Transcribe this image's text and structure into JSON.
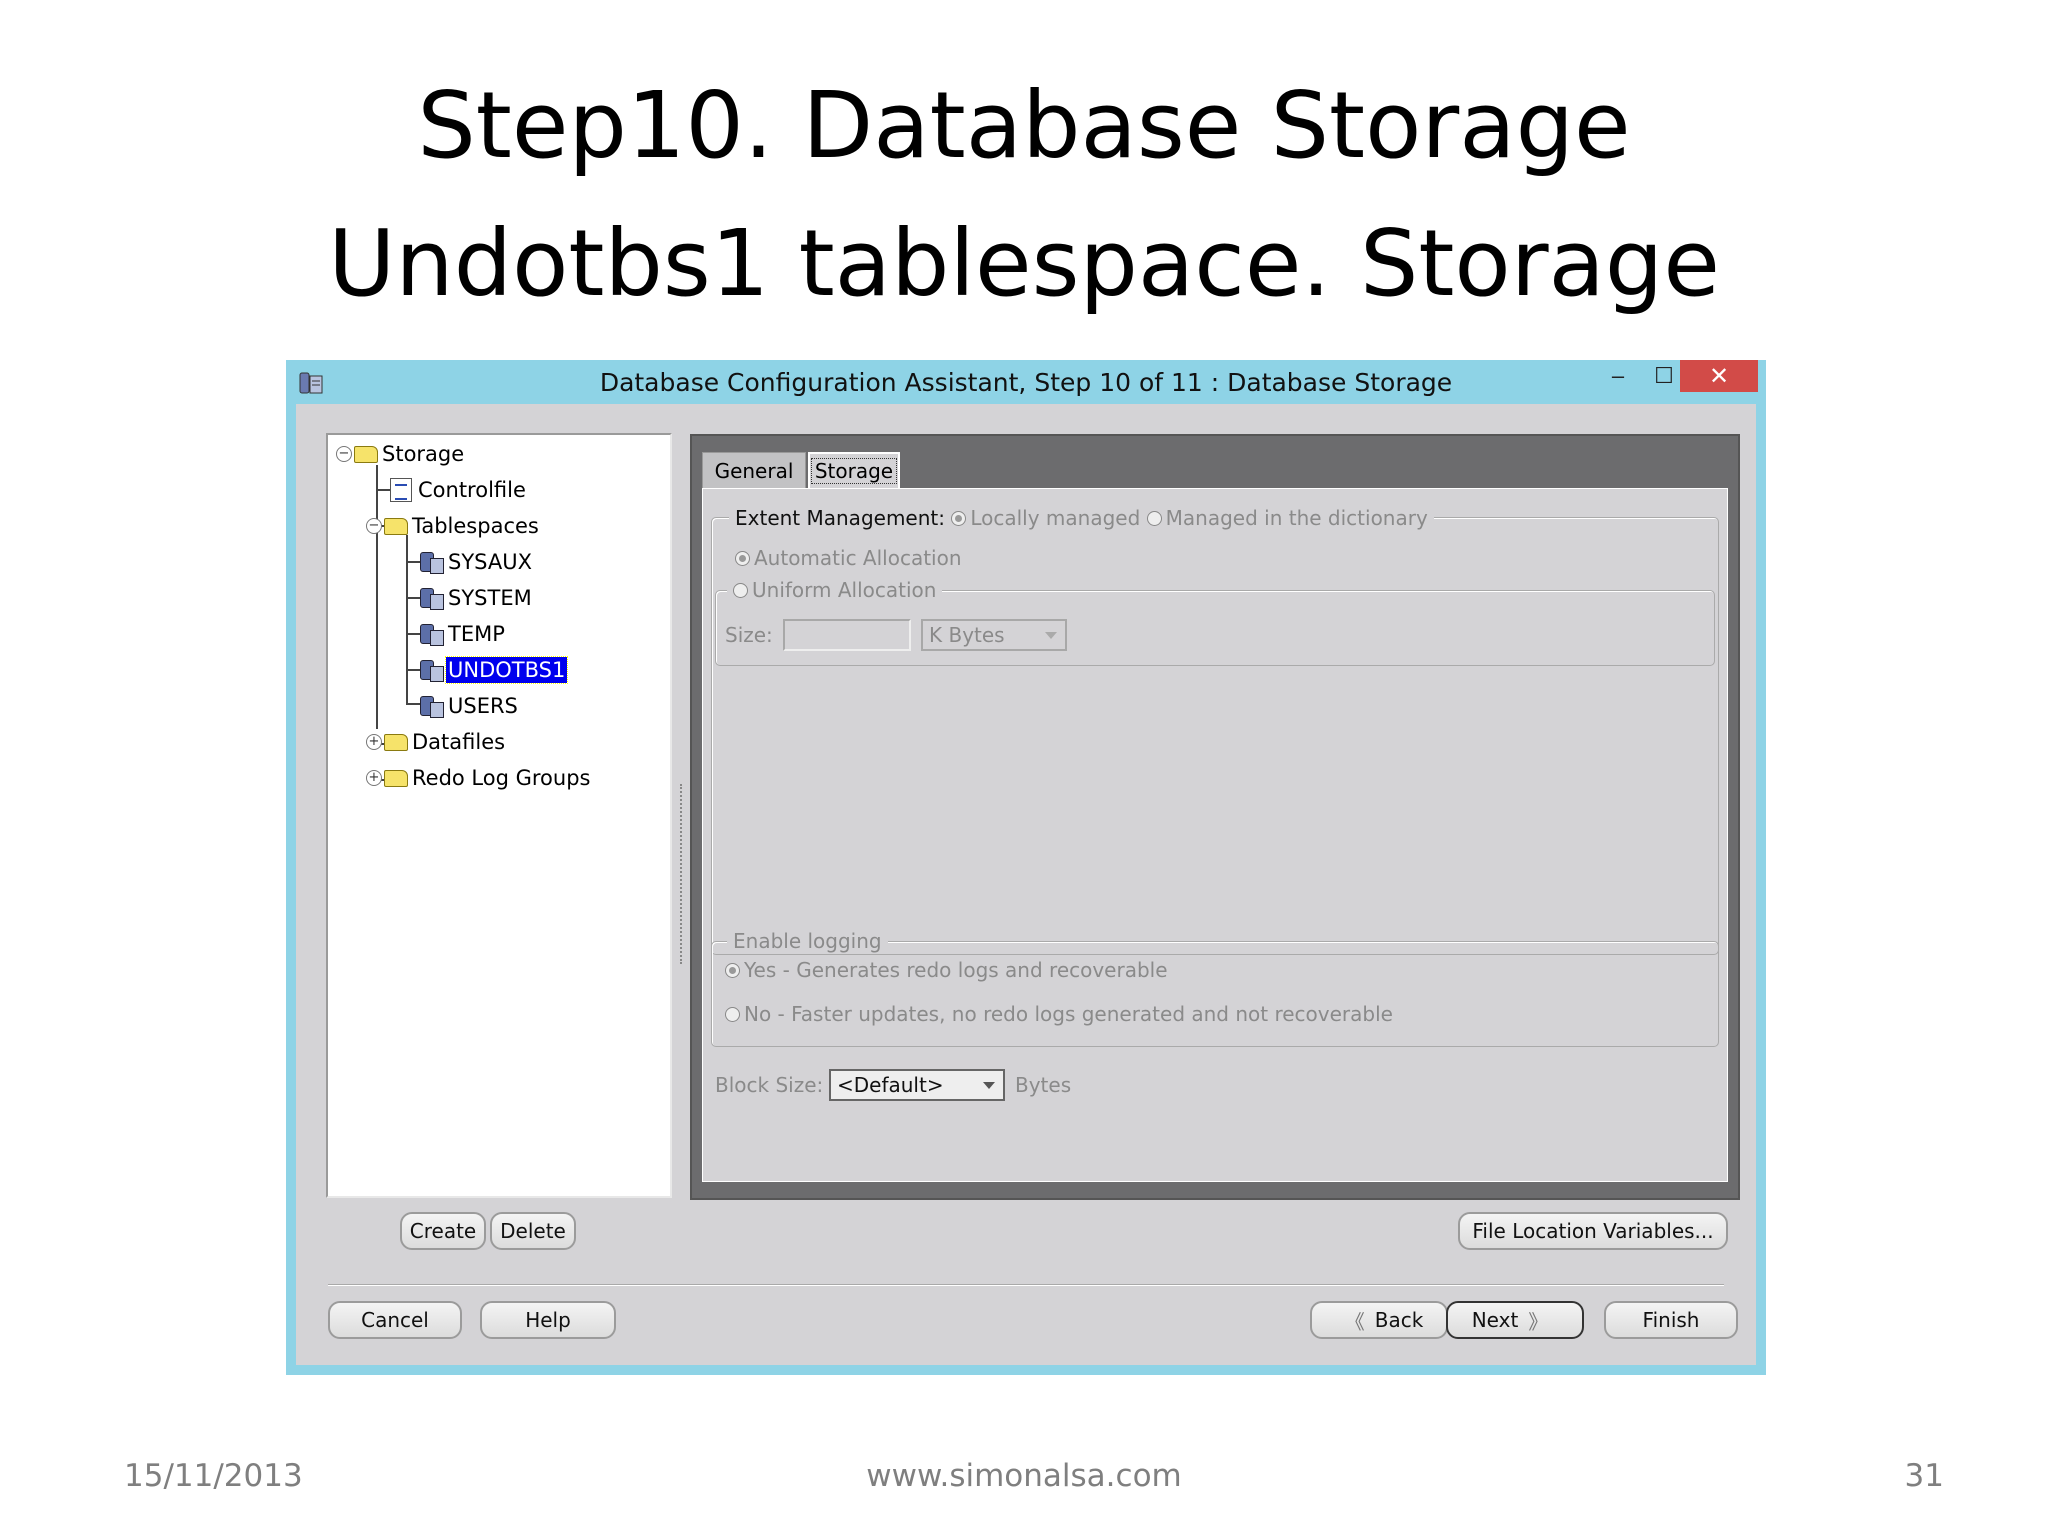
{
  "slide": {
    "title_line1": "Step10. Database Storage",
    "title_line2": "Undotbs1 tablespace. Storage",
    "footer_date": "15/11/2013",
    "footer_url": "www.simonalsa.com",
    "footer_page": "31"
  },
  "window": {
    "title": "Database Configuration Assistant, Step 10 of 11 : Database Storage",
    "min_glyph": "–",
    "max_glyph": "☐",
    "close_glyph": "✕",
    "accent": "#8ed3e6",
    "close_color": "#d24b48"
  },
  "tree": {
    "storage": "Storage",
    "controlfile": "Controlfile",
    "tablespaces": "Tablespaces",
    "sysaux": "SYSAUX",
    "system": "SYSTEM",
    "temp": "TEMP",
    "undotbs1": "UNDOTBS1",
    "users": "USERS",
    "datafiles": "Datafiles",
    "redo_log_groups": "Redo Log Groups",
    "collapse_glyph": "−",
    "expand_glyph": "+",
    "selection_color": "#0000ee"
  },
  "tabs": {
    "general": "General",
    "storage": "Storage"
  },
  "storage_tab": {
    "extent_label": "Extent Management:",
    "locally_managed": "Locally managed",
    "managed_dictionary": "Managed in the dictionary",
    "automatic_allocation": "Automatic Allocation",
    "uniform_allocation": "Uniform Allocation",
    "size_label": "Size:",
    "size_value": "",
    "size_unit": "K Bytes",
    "enable_logging": "Enable logging",
    "yes_option": "Yes - Generates redo logs and recoverable",
    "no_option": "No - Faster updates, no redo logs generated and not recoverable",
    "block_size_label": "Block Size:",
    "block_size_value": "<Default>",
    "block_size_unit": "Bytes"
  },
  "buttons": {
    "create": "Create",
    "delete": "Delete",
    "file_location": "File Location Variables...",
    "cancel": "Cancel",
    "help": "Help",
    "back": "Back",
    "next": "Next",
    "finish": "Finish",
    "back_chevron": "《",
    "next_chevron": "》"
  }
}
